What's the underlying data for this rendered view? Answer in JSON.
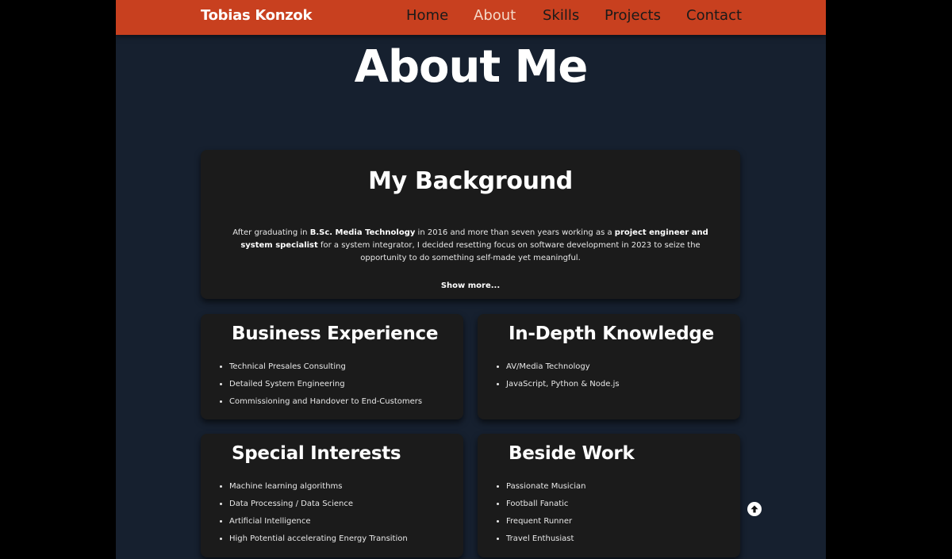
{
  "navbar": {
    "brand": "Tobias Konzok",
    "links": [
      {
        "label": "Home",
        "active": false
      },
      {
        "label": "About",
        "active": true
      },
      {
        "label": "Skills",
        "active": false
      },
      {
        "label": "Projects",
        "active": false
      },
      {
        "label": "Contact",
        "active": false
      }
    ]
  },
  "page_title": "About Me",
  "background": {
    "title": "My Background",
    "text_parts": [
      "After graduating in ",
      "B.Sc. Media Technology",
      " in 2016 and more than seven years working as a ",
      "project engineer and system specialist",
      " for a system integrator, I decided resetting focus on software development in 2023 to seize the opportunity to do something self-made yet meaningful."
    ],
    "show_more": "Show more..."
  },
  "cards": {
    "business": {
      "title": "Business Experience",
      "items": [
        "Technical Presales Consulting",
        "Detailed System Engineering",
        "Commissioning and Handover to End-Customers"
      ]
    },
    "knowledge": {
      "title": "In-Depth Knowledge",
      "items": [
        "AV/Media Technology",
        "JavaScript, Python & Node.js"
      ]
    },
    "interests": {
      "title": "Special Interests",
      "items": [
        "Machine learning algorithms",
        "Data Processing / Data Science",
        "Artificial Intelligence",
        "High Potential accelerating Energy Transition"
      ]
    },
    "beside": {
      "title": "Beside Work",
      "items": [
        "Passionate Musician",
        "Football Fanatic",
        "Frequent Runner",
        "Travel Enthusiast"
      ]
    }
  },
  "icons": {
    "scroll_top": "arrow-up-circle-icon"
  },
  "colors": {
    "navbar": "#c8401f",
    "page_background": "#16202f",
    "card_background": "#1b1b1b",
    "active_link": "#f4d9c8"
  }
}
